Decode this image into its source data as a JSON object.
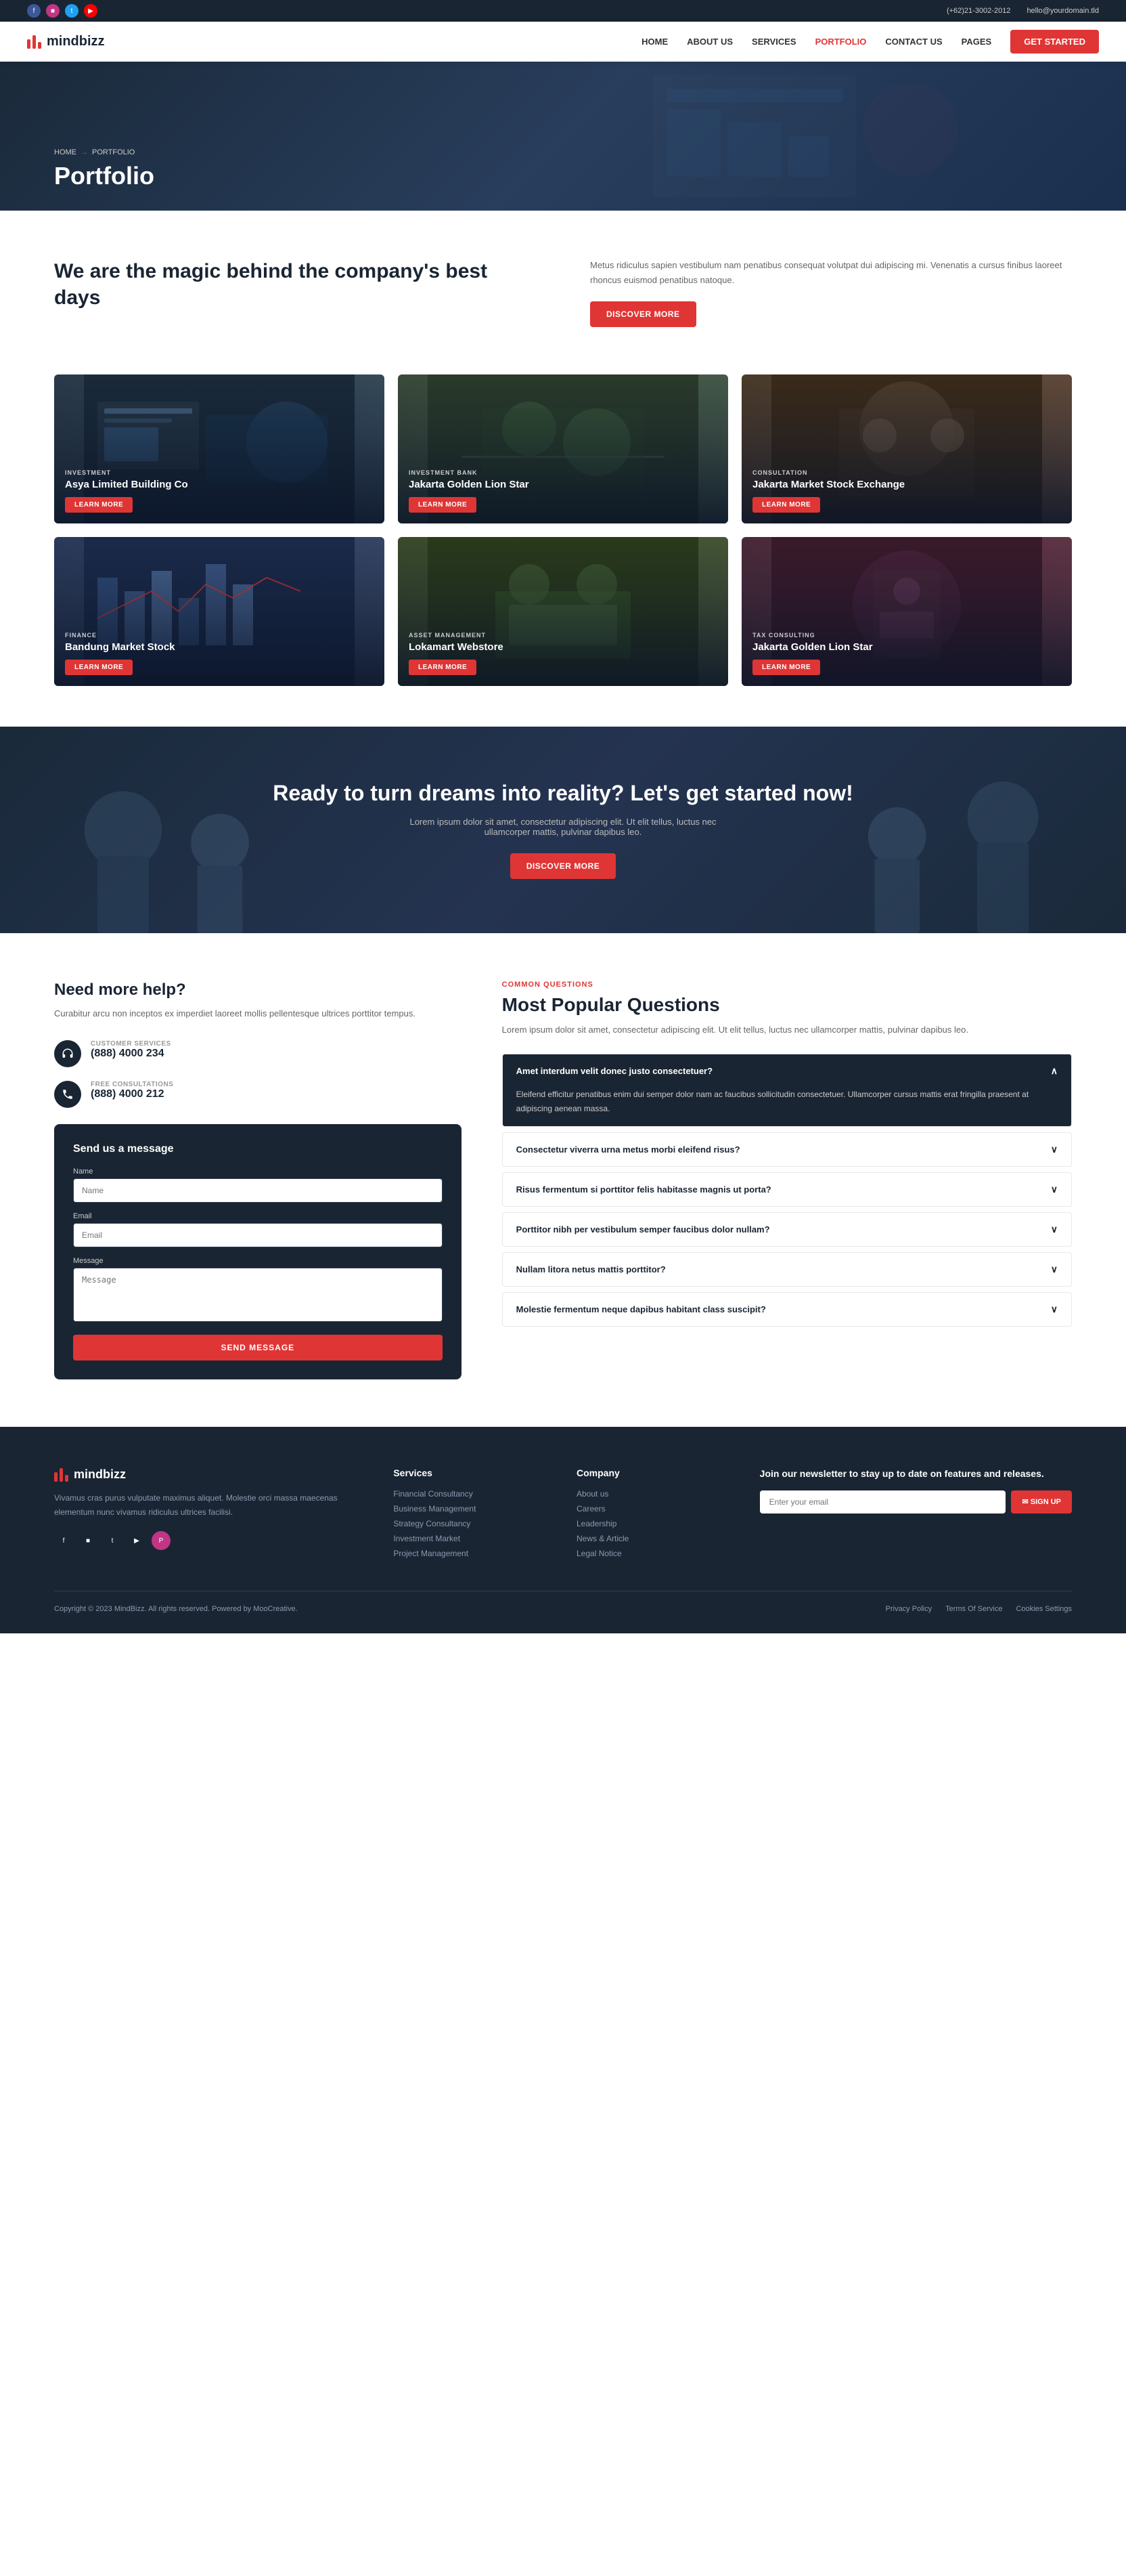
{
  "topbar": {
    "phone": "(+62)21-3002-2012",
    "email": "hello@yourdomain.tld",
    "social": [
      "fb",
      "ig",
      "tw",
      "yt"
    ]
  },
  "navbar": {
    "logo": "mindbizz",
    "links": [
      {
        "label": "HOME",
        "active": false
      },
      {
        "label": "ABOUT US",
        "active": false
      },
      {
        "label": "SERVICES",
        "active": false,
        "dropdown": true
      },
      {
        "label": "PORTFOLIO",
        "active": true
      },
      {
        "label": "CONTACT US",
        "active": false
      },
      {
        "label": "PAGES",
        "active": false,
        "dropdown": true
      }
    ],
    "cta": "GET STARTED"
  },
  "hero": {
    "breadcrumb_home": "HOME",
    "breadcrumb_current": "PORTFOLIO",
    "title": "Portfolio"
  },
  "magic": {
    "title": "We are the magic behind the company's best days",
    "desc": "Metus ridiculus sapien vestibulum nam penatibus consequat volutpat dui adipiscing mi. Venenatis a cursus finibus laoreet rhoncus euismod penatibus natoque.",
    "cta": "DISCOVER MORE"
  },
  "portfolio": {
    "items": [
      {
        "category": "INVESTMENT",
        "name": "Asya Limited Building Co",
        "btn": "LEARN MORE"
      },
      {
        "category": "INVESTMENT BANK",
        "name": "Jakarta Golden Lion Star",
        "btn": "LEARN MORE"
      },
      {
        "category": "CONSULTATION",
        "name": "Jakarta Market Stock Exchange",
        "btn": "LEARN MORE"
      },
      {
        "category": "FINANCE",
        "name": "Bandung Market Stock",
        "btn": "LEARN MORE"
      },
      {
        "category": "ASSET MANAGEMENT",
        "name": "Lokamart Webstore",
        "btn": "LEARN MORE"
      },
      {
        "category": "TAX CONSULTING",
        "name": "Jakarta Golden Lion Star",
        "btn": "LEARN MORE"
      }
    ]
  },
  "cta_banner": {
    "title": "Ready to turn dreams into reality? Let's get started now!",
    "desc": "Lorem ipsum dolor sit amet, consectetur adipiscing elit. Ut elit tellus, luctus nec ullamcorper mattis, pulvinar dapibus leo.",
    "btn": "DISCOVER MORE"
  },
  "help": {
    "title": "Need more help?",
    "desc": "Curabitur arcu non inceptos ex imperdiet laoreet mollis pellentesque ultrices porttitor tempus.",
    "customer_label": "CUSTOMER SERVICES",
    "customer_phone": "(888) 4000 234",
    "free_label": "FREE CONSULTATIONS",
    "free_phone": "(888) 4000 212",
    "form_title": "Send us a message",
    "name_label": "Name",
    "name_placeholder": "Name",
    "email_label": "Email",
    "email_placeholder": "Email",
    "message_label": "Message",
    "message_placeholder": "Message",
    "send_btn": "SEND MESSAGE"
  },
  "faq": {
    "tag": "COMMON QUESTIONS",
    "title": "Most Popular Questions",
    "desc": "Lorem ipsum dolor sit amet, consectetur adipiscing elit. Ut elit tellus, luctus nec ullamcorper mattis, pulvinar dapibus leo.",
    "desc_highlight": "mattis,",
    "items": [
      {
        "question": "Amet interdum velit donec justo consectetuer?",
        "answer": "Eleifend efficitur penatibus enim dui semper dolor nam ac faucibus sollicitudin consectetuer. Ullamcorper cursus mattis erat fringilla praesent at adipiscing aenean massa.",
        "active": true
      },
      {
        "question": "Consectetur viverra urna metus morbi eleifend risus?",
        "active": false
      },
      {
        "question": "Risus fermentum si porttitor felis habitasse magnis ut porta?",
        "active": false
      },
      {
        "question": "Porttitor nibh per vestibulum semper faucibus dolor nullam?",
        "active": false
      },
      {
        "question": "Nullam litora netus mattis porttitor?",
        "active": false
      },
      {
        "question": "Molestie fermentum neque dapibus habitant class suscipit?",
        "active": false
      }
    ]
  },
  "footer": {
    "logo": "mindbizz",
    "desc": "Vivamus cras purus vulputate maximus aliquet. Molestie orci massa maecenas elementum nunc vivamus ridiculus ultrices facilisi.",
    "social": [
      "fb",
      "ig",
      "tw",
      "yt",
      "pi"
    ],
    "services_title": "Services",
    "services_links": [
      "Financial Consultancy",
      "Business Management",
      "Strategy Consultancy",
      "Investment Market",
      "Project Management"
    ],
    "company_title": "Company",
    "company_links": [
      "About us",
      "Careers",
      "Leadership",
      "News & Article",
      "Legal Notice"
    ],
    "newsletter_title": "Join our newsletter to stay up to date on features and releases.",
    "newsletter_placeholder": "Enter your email",
    "newsletter_btn": "✉ SIGN UP",
    "copyright": "Copyright © 2023 MindBizz. All rights reserved. Powered by MooCreative.",
    "bottom_links": [
      "Privacy Policy",
      "Terms Of Service",
      "Cookies Settings"
    ]
  }
}
